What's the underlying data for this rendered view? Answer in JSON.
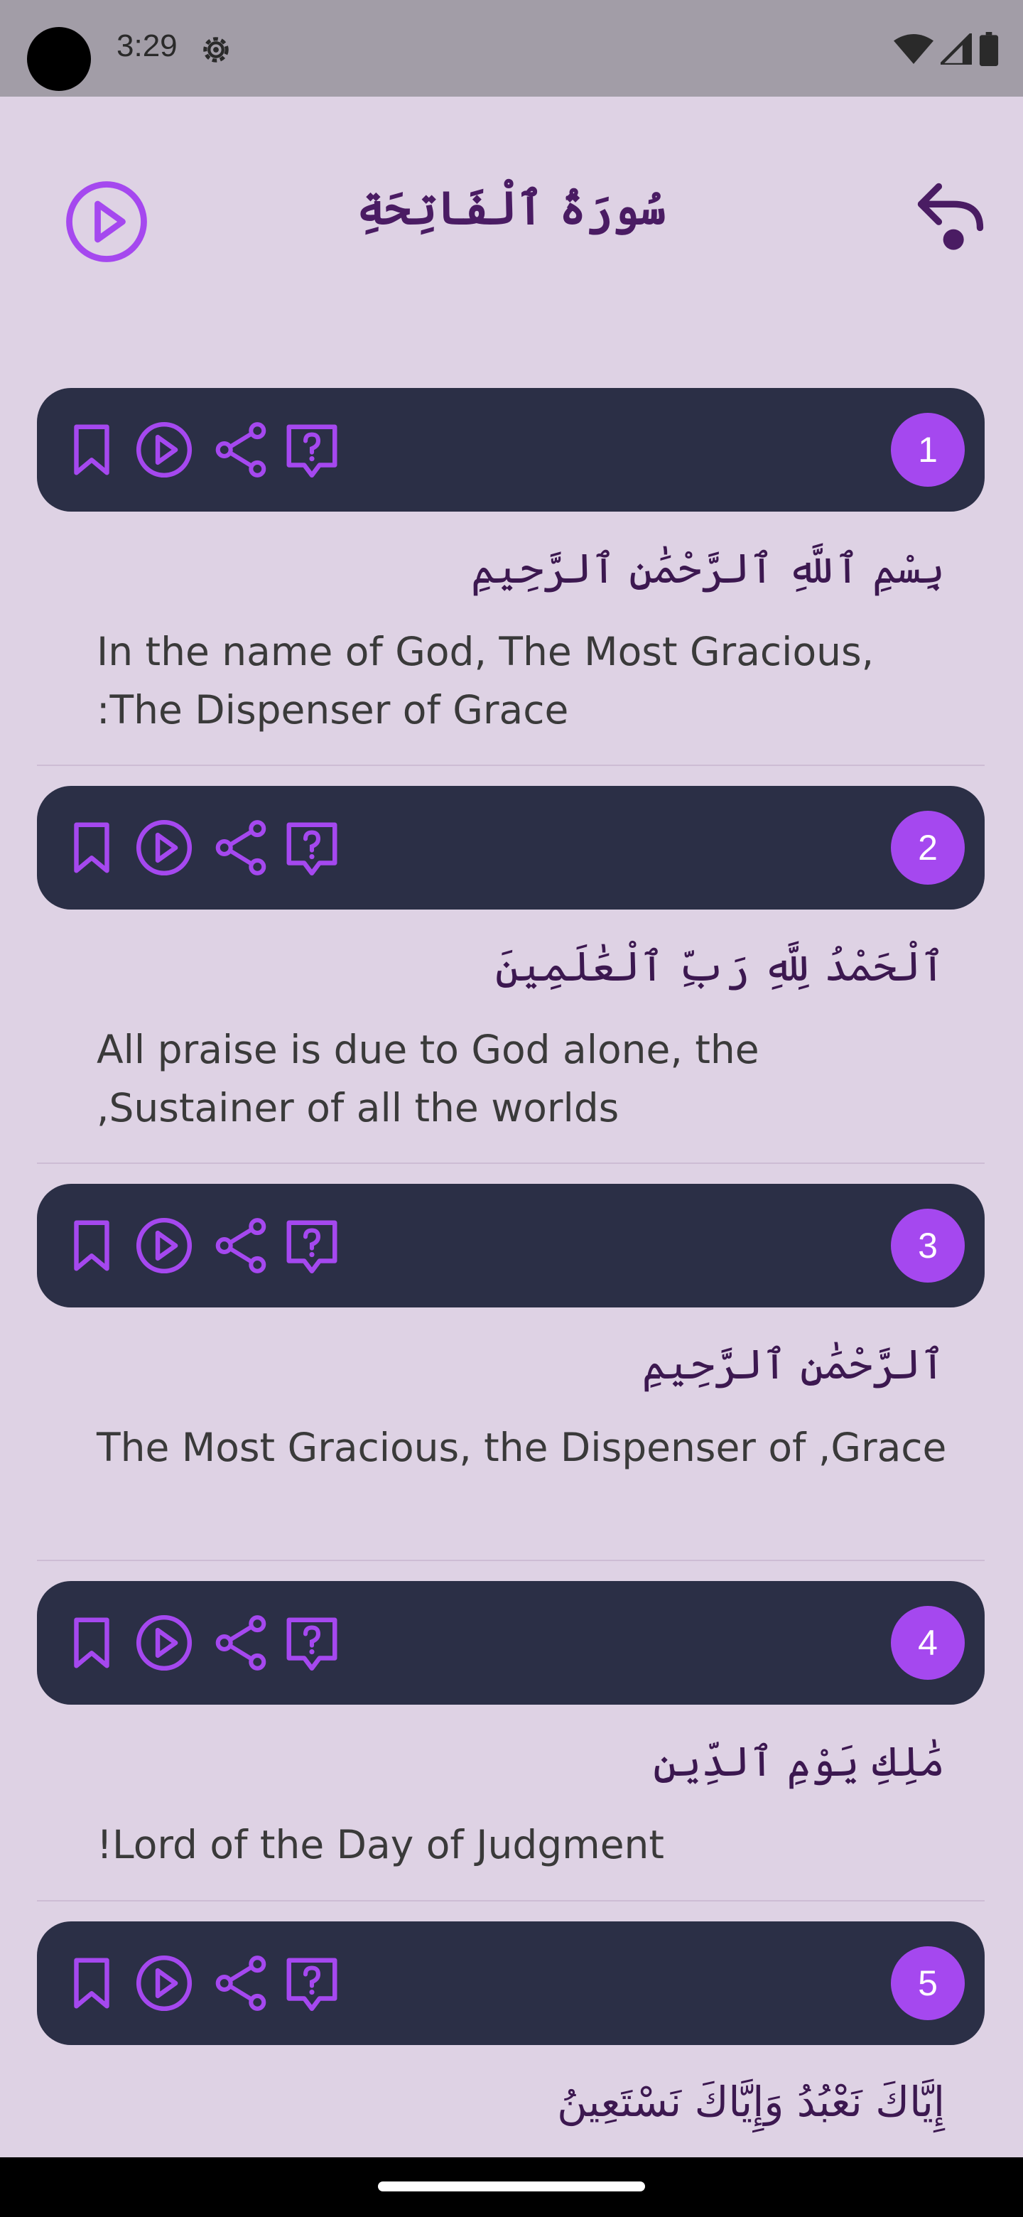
{
  "status_bar": {
    "time": "3:29",
    "icons": [
      "settings-gear-icon",
      "wifi-icon",
      "cell-signal-icon",
      "battery-icon"
    ]
  },
  "header": {
    "title": "سُورَةُ ٱلْفَاتِحَةِ",
    "play_icon": "play-circle-icon",
    "back_icon": "back-arrow-icon"
  },
  "colors": {
    "background": "#ded2e4",
    "accent": "#a548ef",
    "card": "#2b2f46",
    "title": "#4a1c63"
  },
  "verse_actions": [
    "bookmark-icon",
    "play-circle-icon",
    "share-icon",
    "question-bubble-icon"
  ],
  "verses": [
    {
      "number": "1",
      "arabic": "بِسْمِ ٱللَّهِ ٱلرَّحْمَٰنِ ٱلرَّحِيمِ",
      "translation": "In the name of God, The Most Gracious, :The Dispenser of Grace"
    },
    {
      "number": "2",
      "arabic": "ٱلْحَمْدُ لِلَّهِ رَبِّ ٱلْعَٰلَمِينَ",
      "translation": "All praise is due to God alone, the ,Sustainer of all the worlds"
    },
    {
      "number": "3",
      "arabic": "ٱلرَّحْمَٰنِ ٱلرَّحِيمِ",
      "translation": "The Most Gracious, the Dispenser of ,Grace"
    },
    {
      "number": "4",
      "arabic": "مَٰلِكِ يَوْمِ ٱلدِّينِ",
      "translation": "!Lord of the Day of Judgment"
    },
    {
      "number": "5",
      "arabic": "إِيَّاكَ نَعْبُدُ وَإِيَّاكَ نَسْتَعِينُ",
      "translation": ""
    }
  ]
}
